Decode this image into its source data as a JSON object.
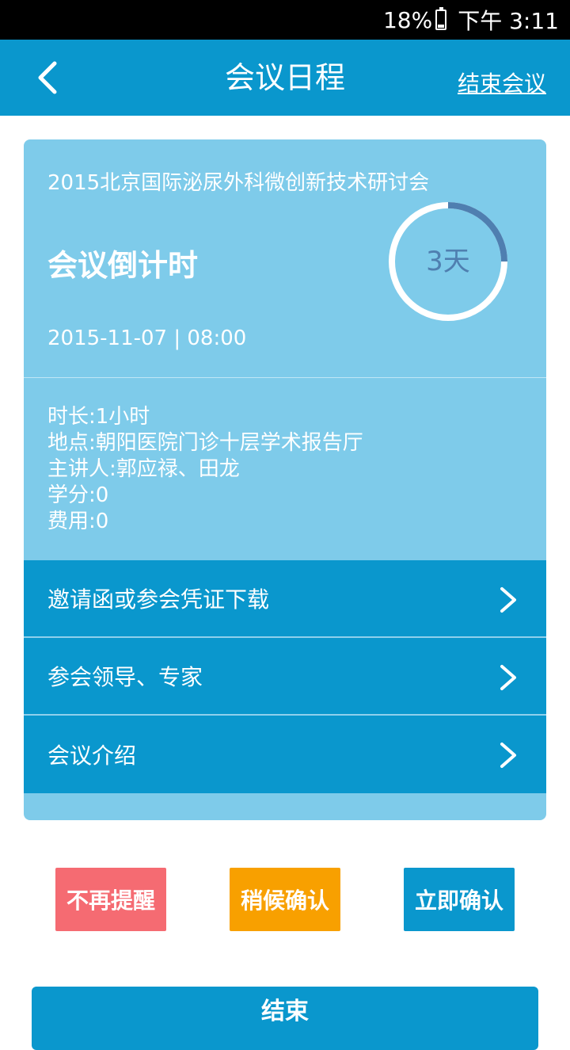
{
  "status_bar": {
    "battery_percent": "18%",
    "time": "下午 3:11"
  },
  "app_bar": {
    "title": "会议日程",
    "end_meeting_link": "结束会议",
    "background_color": "#0a97cd"
  },
  "meeting": {
    "name": "2015北京国际泌尿外科微创新技术研讨会",
    "countdown_label": "会议倒计时",
    "countdown_days": "3天",
    "countdown_ring_fill": 0.25,
    "datetime": "2015-11-07 | 08:00",
    "details": [
      "时长:1小时",
      "地点:朝阳医院门诊十层学术报告厅",
      "主讲人:郭应禄、田龙",
      "学分:0",
      "费用:0"
    ]
  },
  "menu_items": [
    {
      "label": "邀请函或参会凭证下载",
      "icon": "chevron-right-icon"
    },
    {
      "label": "参会领导、专家",
      "icon": "chevron-right-icon"
    },
    {
      "label": "会议介绍",
      "icon": "chevron-right-icon"
    }
  ],
  "actions": {
    "no_remind": "不再提醒",
    "confirm_later": "稍候确认",
    "confirm_now": "立即确认"
  },
  "bottom_button": {
    "label": "结束"
  }
}
